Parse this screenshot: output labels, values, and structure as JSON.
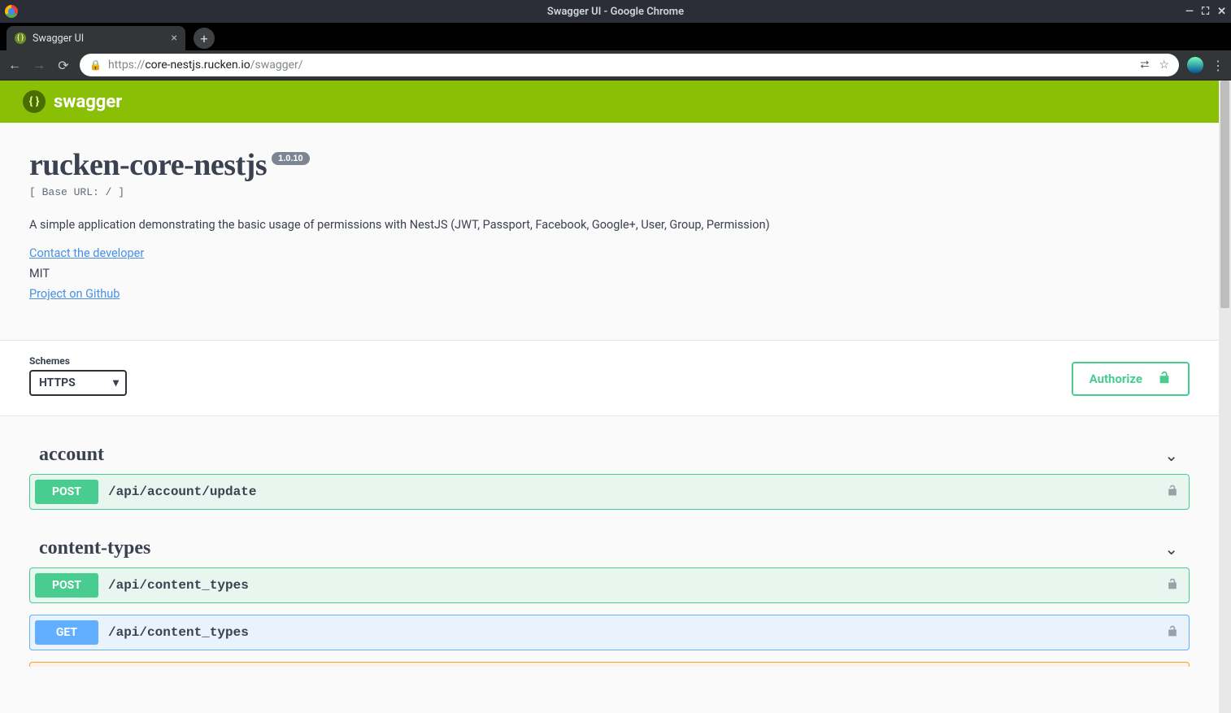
{
  "window": {
    "title": "Swagger UI - Google Chrome"
  },
  "tab": {
    "title": "Swagger UI"
  },
  "address": {
    "url_prefix": "https://",
    "url_host": "core-nestjs.rucken.io",
    "url_path": "/swagger/"
  },
  "swagger": {
    "brand": "swagger",
    "api_title": "rucken-core-nestjs",
    "version": "1.0.10",
    "base_url_label": "[ Base URL: / ]",
    "description": "A simple application demonstrating the basic usage of permissions with NestJS (JWT, Passport, Facebook, Google+, User, Group, Permission)",
    "contact_link": "Contact the developer",
    "license": "MIT",
    "project_link": "Project on Github",
    "schemes_label": "Schemes",
    "scheme_selected": "HTTPS",
    "authorize_label": "Authorize"
  },
  "tags": [
    {
      "name": "account",
      "ops": [
        {
          "method": "POST",
          "path": "/api/account/update"
        }
      ]
    },
    {
      "name": "content-types",
      "ops": [
        {
          "method": "POST",
          "path": "/api/content_types"
        },
        {
          "method": "GET",
          "path": "/api/content_types"
        }
      ]
    }
  ]
}
